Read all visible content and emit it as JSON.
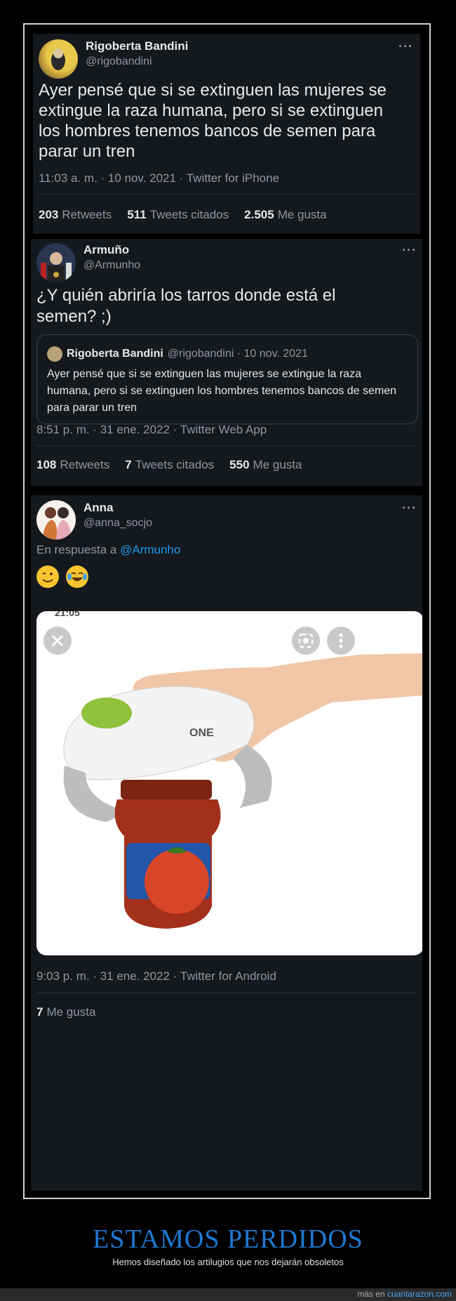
{
  "tweet1": {
    "name": "Rigoberta Bandini",
    "handle": "@rigobandini",
    "text": "Ayer pensé que si se extinguen las mujeres se extingue la raza humana, pero si se extinguen los hombres tenemos bancos de semen para parar un tren",
    "meta": "11:03 a. m. · 10 nov. 2021 · Twitter for iPhone",
    "retweets": "203",
    "retweets_label": "Retweets",
    "quotes": "511",
    "quotes_label": "Tweets citados",
    "likes": "2.505",
    "likes_label": "Me gusta"
  },
  "tweet2": {
    "name": "Armuño",
    "handle": "@Armunho",
    "text": "¿Y quién abriría los tarros donde está el semen? ;)",
    "quote": {
      "name": "Rigoberta Bandini",
      "handle_date": "@rigobandini · 10 nov. 2021",
      "text": "Ayer pensé que si se extinguen las mujeres se extingue la raza humana, pero si se extinguen los hombres tenemos bancos de semen para parar un tren"
    },
    "meta": "8:51 p. m. · 31 ene. 2022 · Twitter Web App",
    "retweets": "108",
    "retweets_label": "Retweets",
    "quotes": "7",
    "quotes_label": "Tweets citados",
    "likes": "550",
    "likes_label": "Me gusta"
  },
  "tweet3": {
    "name": "Anna",
    "handle": "@anna_socjo",
    "reply_prefix": "En respuesta a",
    "reply_to": "@Armunho",
    "photo_status_time": "21:05",
    "product_brand": "ONE",
    "meta": "9:03 p. m. · 31 ene. 2022 · Twitter for Android",
    "likes": "7",
    "likes_label": "Me gusta"
  },
  "footer": {
    "title": "ESTAMOS PERDIDOS",
    "subtitle": "Hemos diseñado los artilugios que nos dejarán obsoletos",
    "more_prefix": "más en",
    "site": "cuantarazon.com"
  },
  "icons": {
    "more": "more-icon",
    "close": "close-icon",
    "lens": "lens-icon",
    "menu": "vertical-dots-icon"
  },
  "colors": {
    "tweet_bg": "#15181c",
    "link": "#1d9bf0",
    "title": "#1f78d1"
  }
}
